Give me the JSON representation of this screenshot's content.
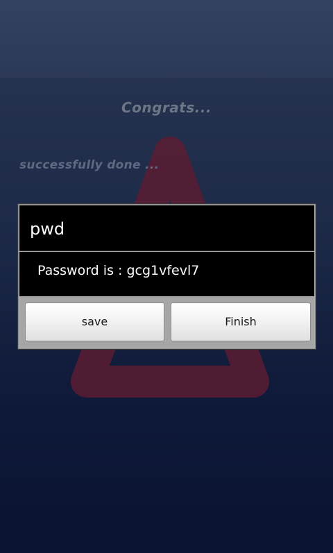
{
  "congrats_text": "Congrats...",
  "success_text": "successfully done ...",
  "dialog": {
    "title": "pwd",
    "message": "Password is : gcg1vfevl7",
    "buttons": {
      "save_label": "save",
      "finish_label": "Finish"
    }
  },
  "colors": {
    "background_top": "#344261",
    "background_bottom": "#0a1331",
    "watermark": "#6a1f36",
    "dialog_bg": "#000000",
    "button_bar": "#a6a6a6"
  },
  "icons": {
    "watermark": "triangle-logo-icon"
  }
}
